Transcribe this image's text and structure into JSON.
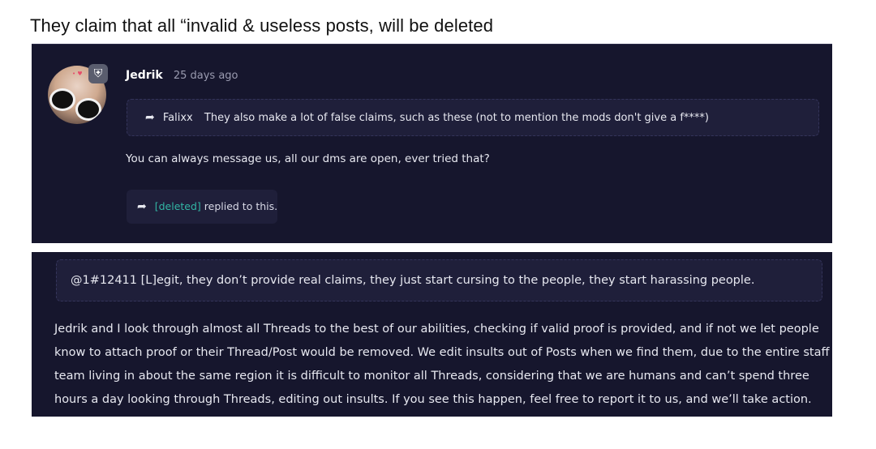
{
  "caption": "They claim that all “invalid & useless posts, will be deleted",
  "post": {
    "author": "Jedrik",
    "timestamp": "25 days ago",
    "avatar_icon": "avatar-image",
    "badge_icon": "moderator-shield-icon",
    "quote": {
      "author": "Falixx",
      "text": "They also make a lot of false claims, such as these (not to mention the mods don't give a f****)"
    },
    "body": "You can always message us, all our dms are open, ever tried that?",
    "reply_notice": {
      "user": "[deleted]",
      "text": " replied to this."
    }
  },
  "second_post": {
    "quote_text": "@1#12411 [L]egit, they don’t provide real claims, they just start cursing to the people, they start harassing people.",
    "lines": [
      "Jedrik and I look through almost all Threads to the best of our abilities, checking if valid proof is provided, and if not we let people",
      "know to attach proof or their Thread/Post would be removed. We edit insults out of Posts when we find them, due to the entire staff",
      "team living in about the same region it is difficult to monitor all Threads, considering that we are humans and can’t spend three",
      "hours a day looking through Threads, editing out insults. If you see this happen, feel free to report it to us, and we’ll take action."
    ]
  },
  "colors": {
    "panel_bg": "#16162d",
    "quote_bg": "#1f1f3a",
    "accent_teal": "#32b5a4"
  }
}
